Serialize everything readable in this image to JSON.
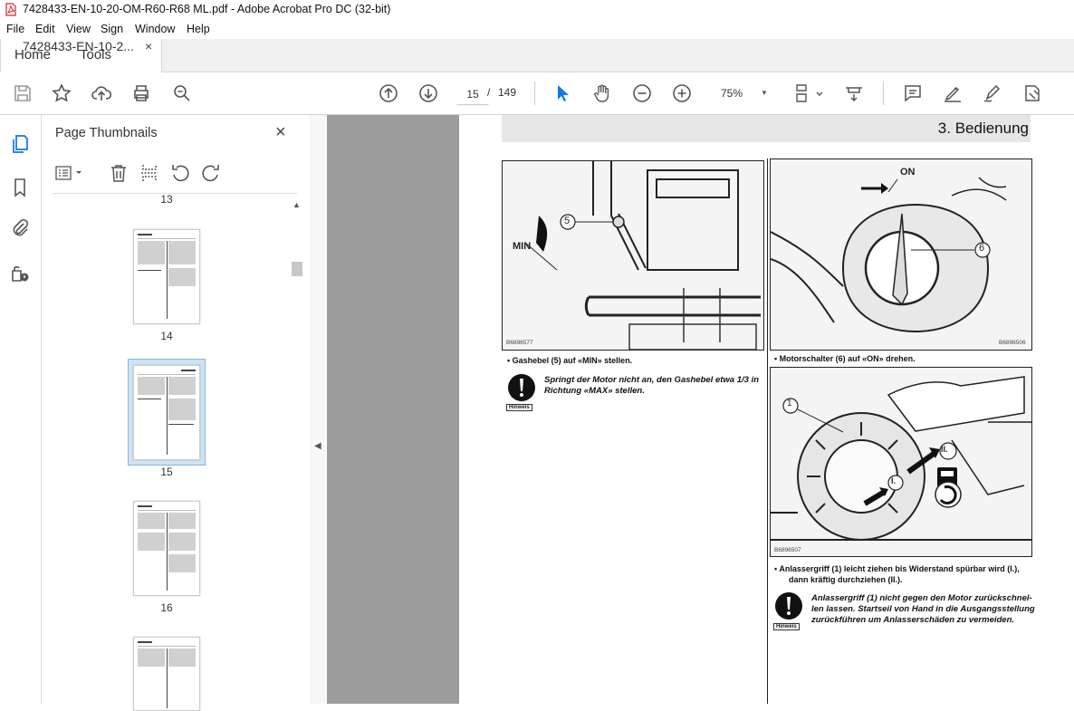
{
  "window": {
    "title": "7428433-EN-10-20-OM-R60-R68 ML.pdf - Adobe Acrobat Pro DC (32-bit)"
  },
  "menu": [
    "File",
    "Edit",
    "View",
    "Sign",
    "Window",
    "Help"
  ],
  "tabs": {
    "home": "Home",
    "tools": "Tools",
    "document": "7428433-EN-10-2...",
    "close_glyph": "×"
  },
  "toolbar": {
    "current_page": "15",
    "separator": "/",
    "total_pages": "149",
    "zoom": "75%"
  },
  "thumbnails": {
    "title": "Page Thumbnails",
    "close_glyph": "×",
    "pages": [
      {
        "label": "13"
      },
      {
        "label": "14"
      },
      {
        "label": "15",
        "selected": true
      },
      {
        "label": "16"
      }
    ]
  },
  "document": {
    "chapter": "3. Bedienung",
    "fig1": {
      "callout": "5",
      "min_label": "MIN",
      "code": "B6896577"
    },
    "fig2": {
      "callout": "6",
      "on_label": "ON",
      "code": "B6896506"
    },
    "fig3": {
      "callout": "1",
      "step1": "I.",
      "step2": "II.",
      "code": "B6896507"
    },
    "bullet1": "•   Gashebel (5) auf «MIN» stellen.",
    "note1_line1": "Springt der Motor nicht an, den Gashebel etwa 1/3 in",
    "note1_line2": "Richtung «MAX» stellen.",
    "hinweis": "Hinweis",
    "bullet2": "•   Motorschalter (6) auf «ON» drehen.",
    "bullet3_line1": "•   Anlassergriff (1) leicht ziehen bis Widerstand spürbar wird (I.),",
    "bullet3_line2": "dann kräftig durchziehen (II.).",
    "note2_line1": "Anlassergriff (1) nicht gegen den Motor zurückschnel-",
    "note2_line2": "len lassen. Startseil von Hand in die Ausgangsstellung",
    "note2_line3": "zurückführen um Anlasserschäden zu vermeiden."
  },
  "colors": {
    "accent": "#1473e6",
    "selection": "#cfe3f3",
    "doc_bg": "#9c9c9c",
    "pdf_red": "#e02020"
  }
}
